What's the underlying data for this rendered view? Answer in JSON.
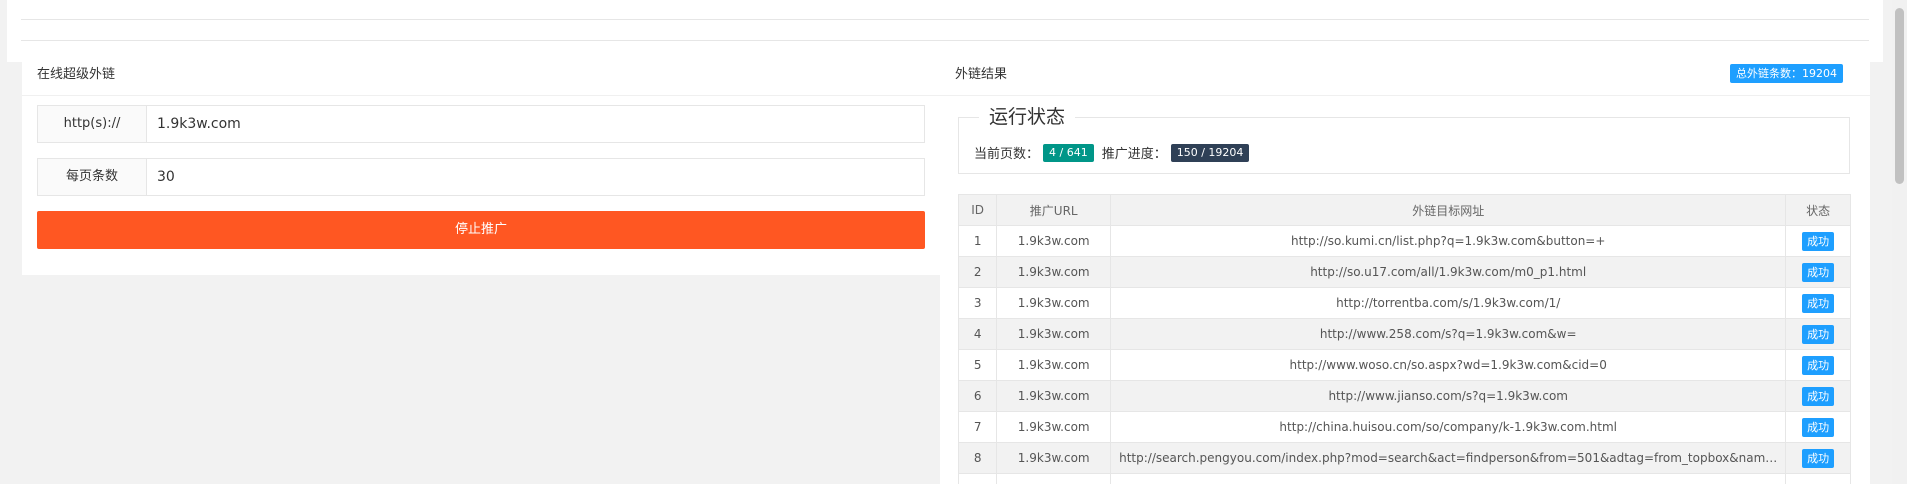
{
  "left": {
    "title": "在线超级外链",
    "url_label": "http(s)://",
    "url_value": "1.9k3w.com",
    "per_page_label": "每页条数",
    "per_page_value": "30",
    "stop_button": "停止推广"
  },
  "right": {
    "title": "外链结果",
    "total_label": "总外链条数：19204",
    "status_legend": "运行状态",
    "current_page_label": "当前页数：",
    "current_page_value": "4 / 641",
    "progress_label": "推广进度：",
    "progress_value": "150 / 19204"
  },
  "table": {
    "headers": [
      "ID",
      "推广URL",
      "外链目标网址",
      "状态"
    ],
    "rows": [
      {
        "id": "1",
        "url": "1.9k3w.com",
        "target": "http://so.kumi.cn/list.php?q=1.9k3w.com&button=+",
        "status": "成功"
      },
      {
        "id": "2",
        "url": "1.9k3w.com",
        "target": "http://so.u17.com/all/1.9k3w.com/m0_p1.html",
        "status": "成功"
      },
      {
        "id": "3",
        "url": "1.9k3w.com",
        "target": "http://torrentba.com/s/1.9k3w.com/1/",
        "status": "成功"
      },
      {
        "id": "4",
        "url": "1.9k3w.com",
        "target": "http://www.258.com/s?q=1.9k3w.com&w=",
        "status": "成功"
      },
      {
        "id": "5",
        "url": "1.9k3w.com",
        "target": "http://www.woso.cn/so.aspx?wd=1.9k3w.com&cid=0",
        "status": "成功"
      },
      {
        "id": "6",
        "url": "1.9k3w.com",
        "target": "http://www.jianso.com/s?q=1.9k3w.com",
        "status": "成功"
      },
      {
        "id": "7",
        "url": "1.9k3w.com",
        "target": "http://china.huisou.com/so/company/k-1.9k3w.com.html",
        "status": "成功"
      },
      {
        "id": "8",
        "url": "1.9k3w.com",
        "target": "http://search.pengyou.com/index.php?mod=search&act=findperson&from=501&adtag=from_topbox&nam…",
        "status": "成功"
      }
    ]
  }
}
